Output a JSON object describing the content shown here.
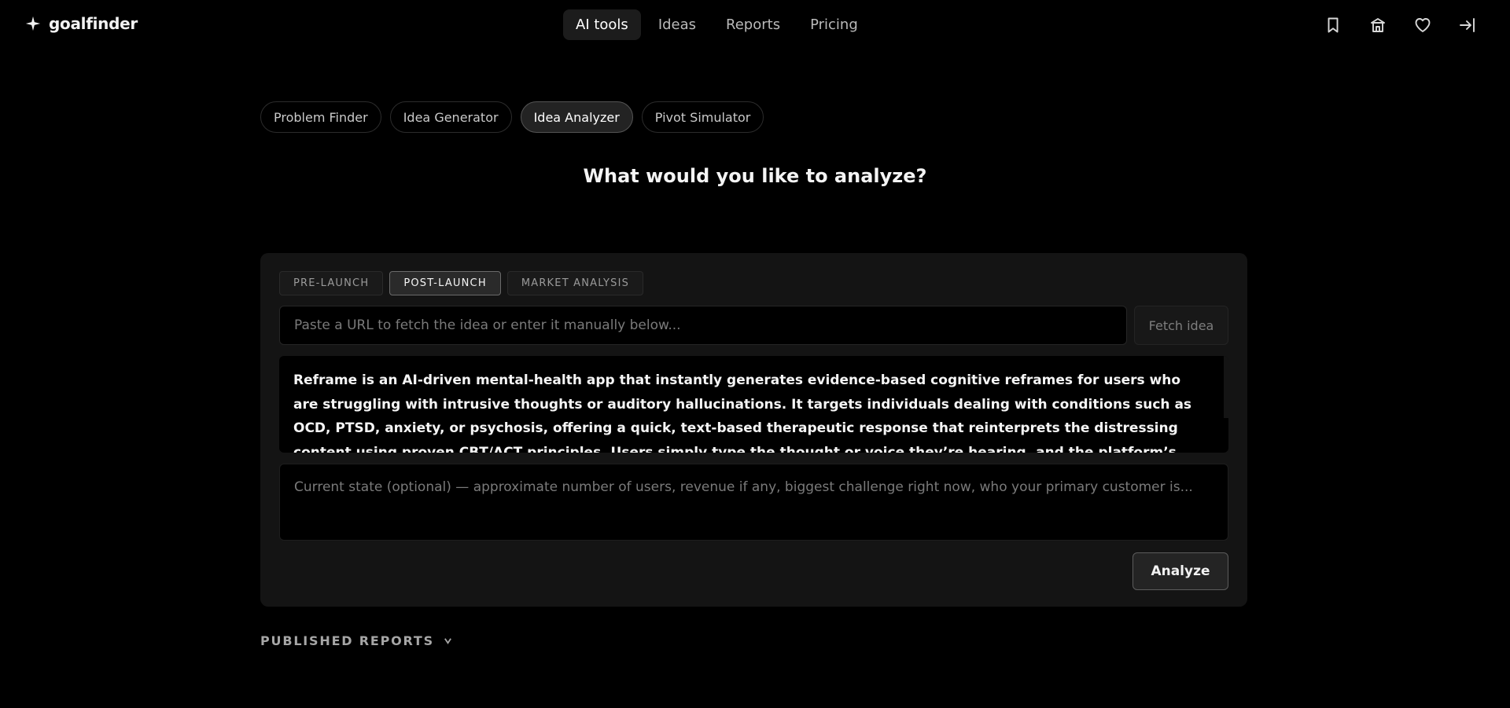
{
  "brand": {
    "name": "goalfinder"
  },
  "nav": {
    "items": [
      {
        "label": "AI tools",
        "active": true
      },
      {
        "label": "Ideas",
        "active": false
      },
      {
        "label": "Reports",
        "active": false
      },
      {
        "label": "Pricing",
        "active": false
      }
    ]
  },
  "header_icons": [
    "bookmark-icon",
    "store-icon",
    "heart-icon",
    "sign-in-icon"
  ],
  "tools": {
    "items": [
      {
        "label": "Problem Finder",
        "active": false
      },
      {
        "label": "Idea Generator",
        "active": false
      },
      {
        "label": "Idea Analyzer",
        "active": true
      },
      {
        "label": "Pivot Simulator",
        "active": false
      }
    ]
  },
  "main": {
    "title": "What would you like to analyze?"
  },
  "form": {
    "segments": [
      {
        "label": "PRE-LAUNCH",
        "active": false
      },
      {
        "label": "POST-LAUNCH",
        "active": true
      },
      {
        "label": "MARKET ANALYSIS",
        "active": false
      }
    ],
    "url_placeholder": "Paste a URL to fetch the idea or enter it manually below...",
    "fetch_label": "Fetch idea",
    "idea_text": "Reframe is an AI-driven mental-health app that instantly generates evidence-based cognitive reframes for users who are struggling with intrusive thoughts or auditory hallucinations. It targets individuals dealing with conditions such as OCD, PTSD, anxiety, or psychosis, offering a quick, text-based therapeutic response that reinterprets the distressing content using proven CBT/ACT principles. Users simply type the thought or voice they’re hearing, and the platform’s language model returns a concise, clinically informed reframe to help reduce distress and",
    "state_placeholder": "Current state (optional) — approximate number of users, revenue if any, biggest challenge right now, who your primary customer is...",
    "analyze_label": "Analyze"
  },
  "published": {
    "label": "PUBLISHED REPORTS"
  },
  "colors": {
    "background": "#000000",
    "card": "#141414",
    "accent_border": "#5c5c5c"
  }
}
